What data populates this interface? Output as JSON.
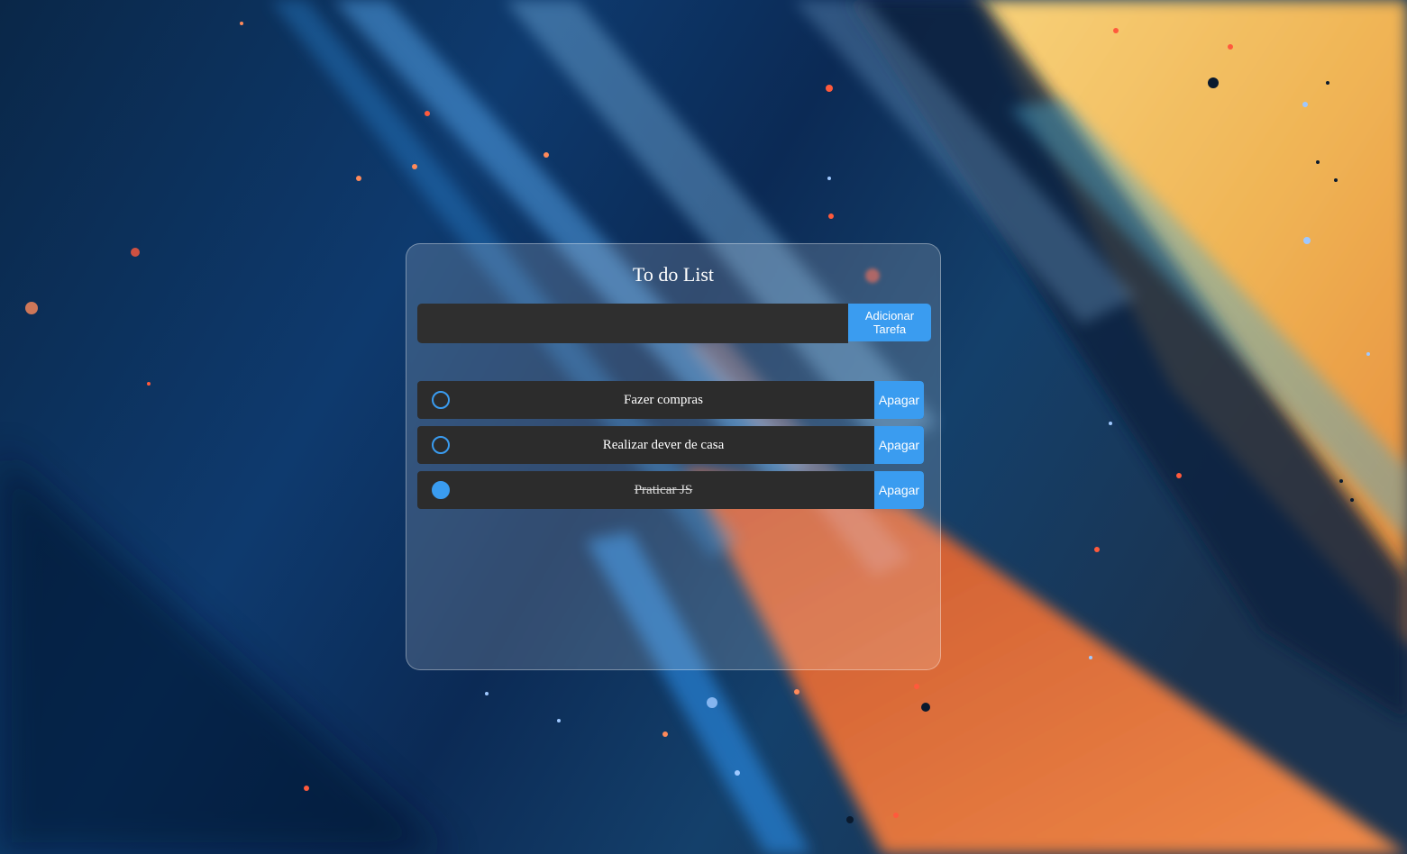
{
  "app": {
    "title": "To do List"
  },
  "add_form": {
    "input_value": "",
    "input_placeholder": "",
    "button_label": "Adicionar Tarefa"
  },
  "tasks": [
    {
      "text": "Fazer compras",
      "completed": false,
      "delete_label": "Apagar"
    },
    {
      "text": "Realizar dever de casa",
      "completed": false,
      "delete_label": "Apagar"
    },
    {
      "text": "Praticar JS",
      "completed": true,
      "delete_label": "Apagar"
    }
  ],
  "colors": {
    "accent": "#3a9cf0",
    "item_background": "#2c2c2c",
    "input_background": "#2f2f2f",
    "text": "#ffffff"
  },
  "icons": {
    "unchecked": "circle-outline-icon",
    "checked": "circle-filled-icon"
  }
}
